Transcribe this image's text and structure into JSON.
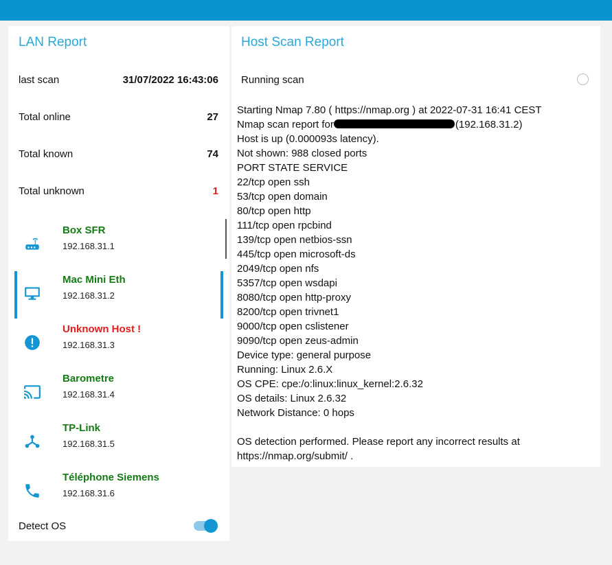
{
  "colors": {
    "topbar": "#0a94cf",
    "title": "#29a8d9",
    "known_host": "#147a14",
    "unknown_host": "#e01c1c",
    "accent": "#1496d2"
  },
  "lan_report": {
    "title": "LAN Report",
    "stats": [
      {
        "label": "last scan",
        "value": "31/07/2022 16:43:06"
      },
      {
        "label": "Total online",
        "value": "27"
      },
      {
        "label": "Total known",
        "value": "74"
      },
      {
        "label": "Total unknown",
        "value": "1"
      }
    ],
    "hosts": [
      {
        "name": "Box SFR",
        "ip": "192.168.31.1",
        "icon": "router-icon",
        "status": "known"
      },
      {
        "name": "Mac Mini Eth",
        "ip": "192.168.31.2",
        "icon": "monitor-icon",
        "status": "known",
        "selected": true
      },
      {
        "name": "Unknown Host !",
        "ip": "192.168.31.3",
        "icon": "alert-icon",
        "status": "unknown"
      },
      {
        "name": "Barometre",
        "ip": "192.168.31.4",
        "icon": "cast-icon",
        "status": "known"
      },
      {
        "name": "TP-Link",
        "ip": "192.168.31.5",
        "icon": "network-icon",
        "status": "known"
      },
      {
        "name": "Téléphone Siemens",
        "ip": "192.168.31.6",
        "icon": "phone-icon",
        "status": "known"
      }
    ],
    "detect_os": {
      "label": "Detect OS",
      "enabled": true
    }
  },
  "host_scan": {
    "title": "Host Scan Report",
    "status": "Running scan",
    "report_prefix": "Nmap scan report for",
    "report_suffix": "(192.168.31.2)",
    "lines": [
      "Starting Nmap 7.80 ( https://nmap.org ) at 2022-07-31 16:41 CEST",
      "Host is up (0.000093s latency).",
      "Not shown: 988 closed ports",
      "PORT STATE SERVICE",
      "22/tcp open ssh",
      "53/tcp open domain",
      "80/tcp open http",
      "111/tcp open rpcbind",
      "139/tcp open netbios-ssn",
      "445/tcp open microsoft-ds",
      "2049/tcp open nfs",
      "5357/tcp open wsdapi",
      "8080/tcp open http-proxy",
      "8200/tcp open trivnet1",
      "9000/tcp open cslistener",
      "9090/tcp open zeus-admin",
      "Device type: general purpose",
      "Running: Linux 2.6.X",
      "OS CPE: cpe:/o:linux:linux_kernel:2.6.32",
      "OS details: Linux 2.6.32",
      "Network Distance: 0 hops",
      "OS detection performed. Please report any incorrect results at",
      "https://nmap.org/submit/ ."
    ]
  }
}
